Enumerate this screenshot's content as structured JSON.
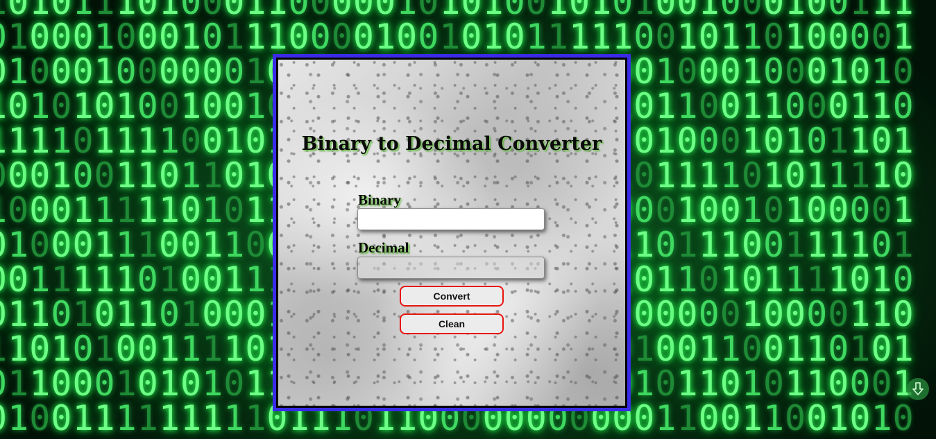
{
  "page": {
    "title": "Binary to Decimal Converter"
  },
  "form": {
    "binary_label": "Binary",
    "binary_value": "",
    "decimal_label": "Decimal",
    "decimal_value": ""
  },
  "buttons": {
    "convert_label": "Convert",
    "clean_label": "Clean"
  },
  "background": {
    "digit_rows": [
      "1010111010001100000101010010101001000100111",
      "0100010001011100001001010111110010110100001",
      "0100010000001010010001110101100100010001010",
      "1010101001001001010011010110010110011000110",
      "1111011110010110101011010111010100010101101",
      "0001001101101011010011000110010111101011110",
      "1000111110101101101101011010100010010100001",
      "0100011100110010101011101011011011100111101",
      "0011111010011100110101001111010110101111010",
      "0110101101000110010011010101000000010000110",
      "1101010011110100110100100110101001100110101",
      "0110001010101111000111001111001011010110001",
      "0100111111111011101100000000000110011001010"
    ],
    "colors": {
      "bright": "#6dff86",
      "dim": "#1f8a36",
      "panel_border": "#3a2be8",
      "button_border": "#e8140f"
    }
  },
  "icons": {
    "scroll_down": "arrow-down-icon"
  }
}
